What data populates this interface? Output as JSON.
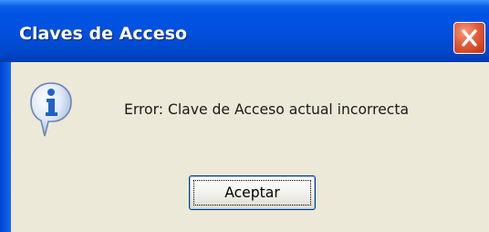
{
  "window": {
    "title": "Claves de Acceso",
    "close_icon": "close-icon"
  },
  "dialog": {
    "icon": "info-icon",
    "message": "Error: Clave de Acceso actual incorrecta",
    "ok_label": "Aceptar"
  },
  "colors": {
    "titlebar": "#0054e3",
    "close_button": "#e25c3c",
    "dialog_background": "#ece9d8",
    "info_icon_blue": "#1e63c8"
  }
}
